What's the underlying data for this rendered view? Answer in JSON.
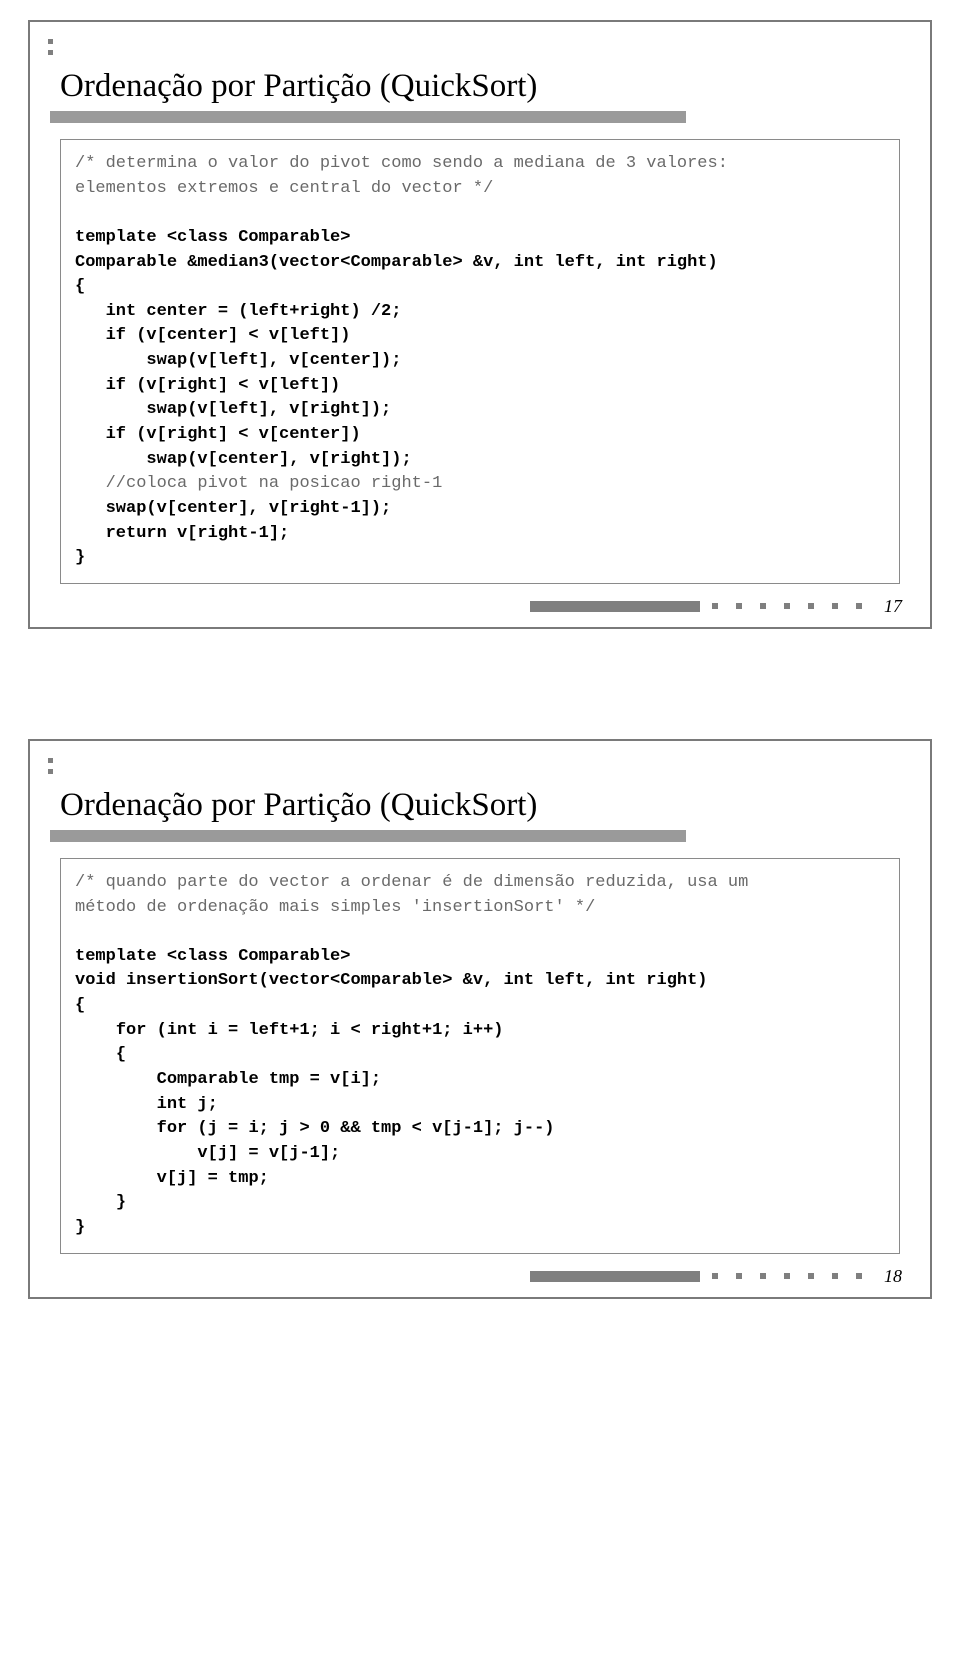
{
  "slide1": {
    "heading": "Ordenação por Partição (QuickSort)",
    "code_comment1": "/* determina o valor do pivot como sendo a mediana de 3 valores:\nelementos extremos e central do vector */",
    "code_line_tpl": "template <class Comparable>",
    "code_line_sig": "Comparable &median3(vector<Comparable> &v, int left, int right)",
    "code_brace_open": "{",
    "code_l1": "   int center = (left+right) /2;",
    "code_l2": "   if (v[center] < v[left])",
    "code_l3": "       swap(v[left], v[center]);",
    "code_l4": "   if (v[right] < v[left])",
    "code_l5": "       swap(v[left], v[right]);",
    "code_l6": "   if (v[right] < v[center])",
    "code_l7": "       swap(v[center], v[right]);",
    "code_c2": "   //coloca pivot na posicao right-1",
    "code_l8": "   swap(v[center], v[right-1]);",
    "code_l9": "   return v[right-1];",
    "code_brace_close": "}",
    "page_num": "17"
  },
  "slide2": {
    "heading": "Ordenação por Partição (QuickSort)",
    "code_comment1": "/* quando parte do vector a ordenar é de dimensão reduzida, usa um\nmétodo de ordenação mais simples 'insertionSort' */",
    "code_line_tpl": "template <class Comparable>",
    "code_line_sig": "void insertionSort(vector<Comparable> &v, int left, int right)",
    "code_brace_open": "{",
    "code_l1": "    for (int i = left+1; i < right+1; i++)",
    "code_l2": "    {",
    "code_l3": "        Comparable tmp = v[i];",
    "code_l4": "        int j;",
    "code_l5": "        for (j = i; j > 0 && tmp < v[j-1]; j--)",
    "code_l6": "            v[j] = v[j-1];",
    "code_l7": "        v[j] = tmp;",
    "code_l8": "    }",
    "code_brace_close": "}",
    "page_num": "18"
  }
}
